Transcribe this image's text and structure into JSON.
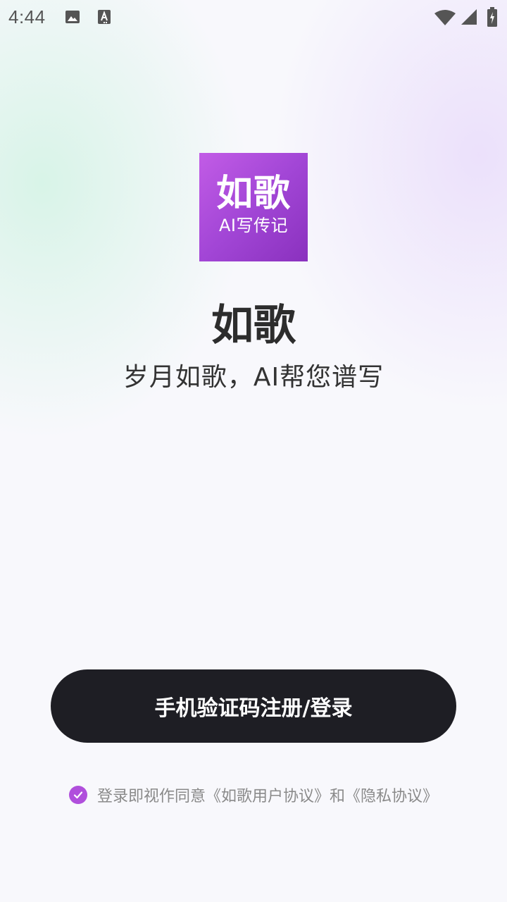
{
  "status_bar": {
    "time": "4:44",
    "icons": [
      "image-icon",
      "font-a-icon",
      "wifi-icon",
      "cell-signal-icon",
      "battery-charging-icon"
    ]
  },
  "logo": {
    "title": "如歌",
    "subtitle": "AI写传记",
    "colors": {
      "gradient_start": "#c25ce6",
      "gradient_end": "#8a31be"
    }
  },
  "app_name": "如歌",
  "tagline": "岁月如歌，AI帮您谱写",
  "login_button": {
    "label": "手机验证码注册/登录",
    "background": "#1e1e24"
  },
  "agreement": {
    "checked": true,
    "check_color": "#b04fdc",
    "prefix": "登录即视作同意",
    "user_agreement": "《如歌用户协议》",
    "conjunction": "和",
    "privacy_agreement": "《隐私协议》"
  }
}
